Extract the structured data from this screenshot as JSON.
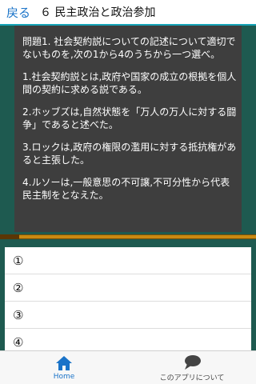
{
  "header": {
    "back_label": "戻る",
    "title": "６ 民主政治と政治参加"
  },
  "question": {
    "prompt": "問題1. 社会契約説についての記述について適切でないものを,次の1から4のうちから一つ選べ。",
    "options": [
      "1.社会契約説とは,政府や国家の成立の根拠を個人間の契約に求める説である。",
      "2.ホッブズは,自然状態を「万人の万人に対する闘争」であると述べた。",
      "3.ロックは,政府の権限の濫用に対する抵抗権があると主張した。",
      "4.ルソーは,一般意思の不可譲,不可分性から代表民主制をとなえた。"
    ]
  },
  "answers": [
    "①",
    "②",
    "③",
    "④"
  ],
  "tabs": {
    "home_label": "Home",
    "about_label": "このアプリについて",
    "home_icon": "home-icon",
    "about_icon": "speech-bubble-icon"
  },
  "colors": {
    "accent": "#1a73c8",
    "board": "#3e3e3e",
    "frame": "#1e5a50",
    "ledge": "#c98a12"
  }
}
